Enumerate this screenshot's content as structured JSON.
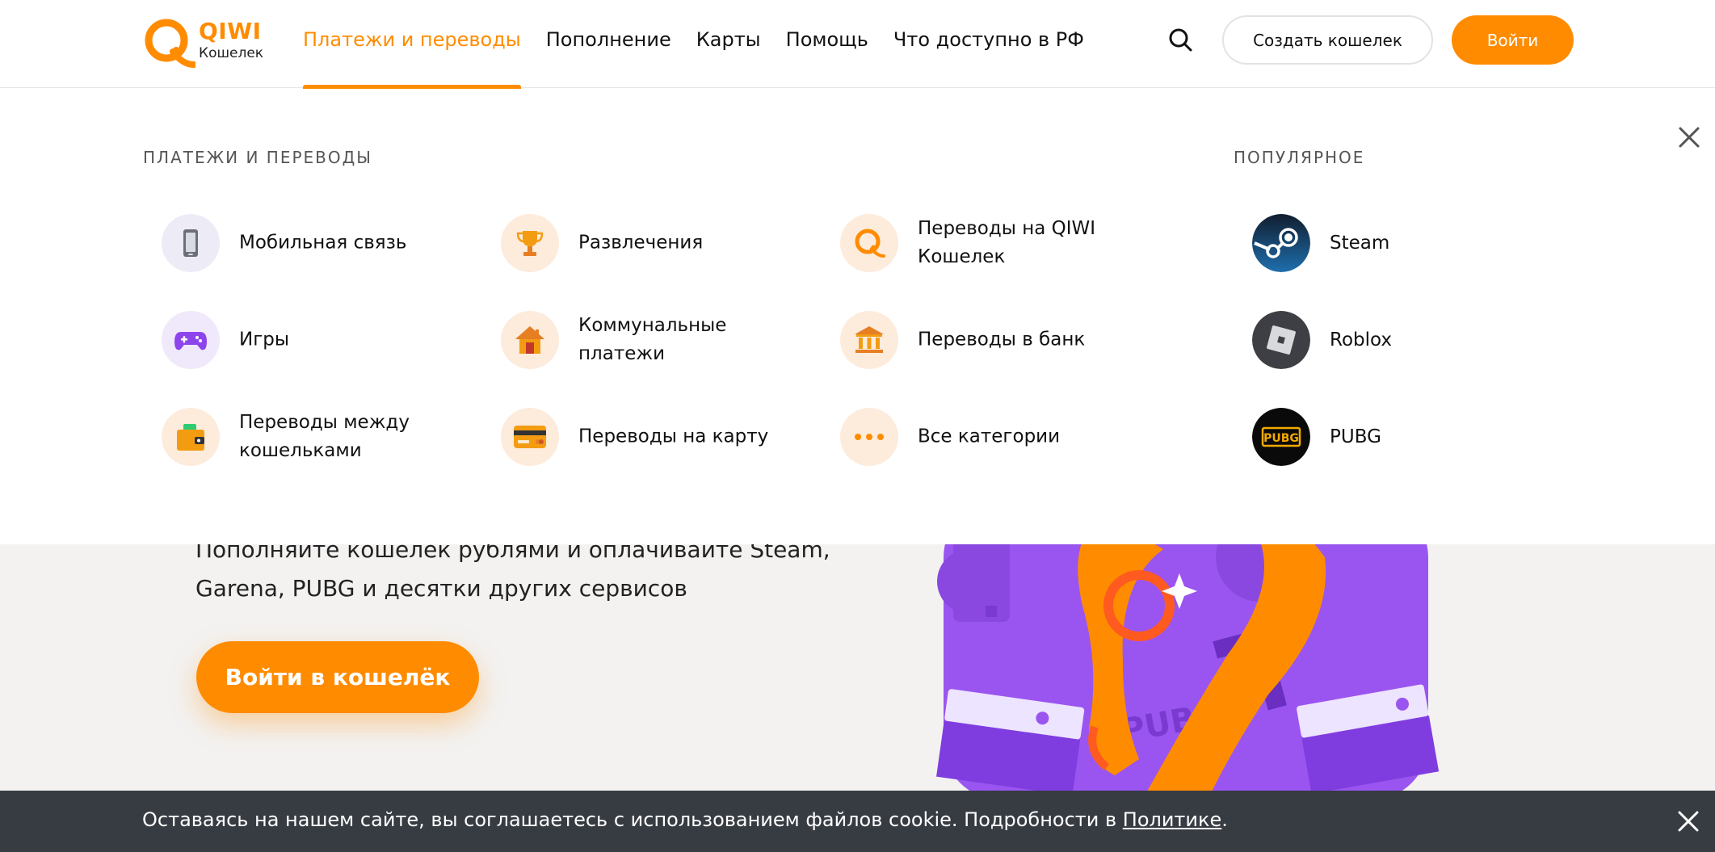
{
  "header": {
    "logo": {
      "name": "QIWI",
      "sub": "Кошелек"
    },
    "nav": [
      {
        "label": "Платежи и переводы",
        "active": true
      },
      {
        "label": "Пополнение"
      },
      {
        "label": "Карты"
      },
      {
        "label": "Помощь"
      },
      {
        "label": "Что доступно в РФ"
      }
    ],
    "search_icon": "search-icon",
    "create_wallet_label": "Создать кошелек",
    "login_label": "Войти"
  },
  "dropdown": {
    "section_title": "ПЛАТЕЖИ И ПЕРЕВОДЫ",
    "items": [
      {
        "label": "Мобильная связь",
        "icon": "mobile-phone-icon"
      },
      {
        "label": "Развлечения",
        "icon": "trophy-icon"
      },
      {
        "label": "Переводы на QIWI Кошелек",
        "icon": "qiwi-logo-icon"
      },
      {
        "label": "Игры",
        "icon": "gamepad-icon"
      },
      {
        "label": "Коммунальные платежи",
        "icon": "house-icon"
      },
      {
        "label": "Переводы в банк",
        "icon": "bank-icon"
      },
      {
        "label": "Переводы между кошельками",
        "icon": "wallet-icon"
      },
      {
        "label": "Переводы на карту",
        "icon": "card-icon"
      },
      {
        "label": "Все категории",
        "icon": "dots-icon"
      }
    ],
    "popular_title": "ПОПУЛЯРНОЕ",
    "popular": [
      {
        "label": "Steam",
        "icon": "steam-icon"
      },
      {
        "label": "Roblox",
        "icon": "roblox-icon"
      },
      {
        "label": "PUBG",
        "icon": "pubg-icon"
      }
    ]
  },
  "hero": {
    "text": "Пополняйте кошелек рублями и оплачивайте Steam, Garena, PUBG и десятки других сервисов",
    "button_label": "Войти в кошелёк",
    "pubg_badge": "PUBG"
  },
  "cookie_bar": {
    "text": "Оставаясь на нашем сайте, вы соглашаетесь с использованием файлов cookie. Подробности в ",
    "link_label": "Политике",
    "tail": "."
  },
  "colors": {
    "accent": "#ff8c00",
    "cookie_bg": "#373b42",
    "hero_bg": "#f3f2f1"
  }
}
